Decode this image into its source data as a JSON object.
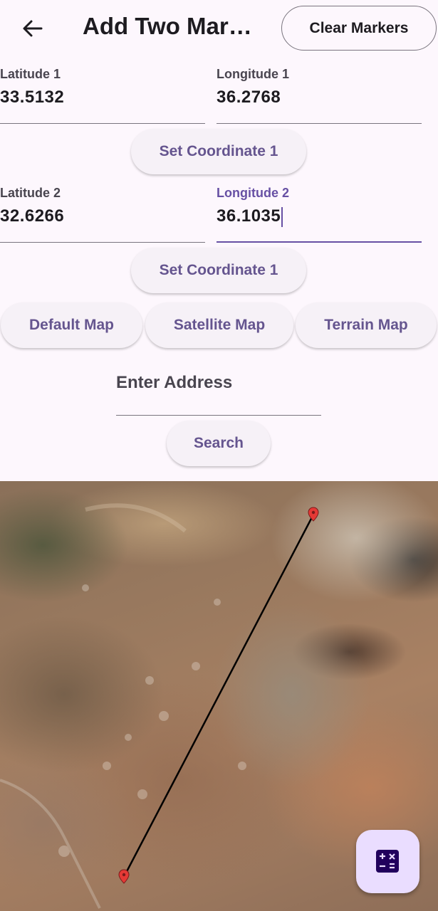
{
  "appbar": {
    "title": "Add Two Markers",
    "clear_label": "Clear Markers"
  },
  "coord1": {
    "lat_label": "Latitude 1",
    "lat_value": "33.5132",
    "lon_label": "Longitude 1",
    "lon_value": "36.2768",
    "set_label": "Set Coordinate 1"
  },
  "coord2": {
    "lat_label": "Latitude 2",
    "lat_value": "32.6266",
    "lon_label": "Longitude 2",
    "lon_value": "36.1035",
    "set_label": "Set Coordinate 1"
  },
  "map_types": {
    "default_label": "Default Map",
    "satellite_label": "Satellite Map",
    "terrain_label": "Terrain Map"
  },
  "address": {
    "placeholder": "Enter Address",
    "search_label": "Search"
  },
  "map": {
    "type": "satellite",
    "line_color": "#000000",
    "marker_color": "#e53935"
  },
  "colors": {
    "accent": "#6750a4",
    "fab_bg": "#eaddff",
    "background": "#fdf7fd"
  },
  "fab": {
    "icon": "calculate-icon"
  }
}
